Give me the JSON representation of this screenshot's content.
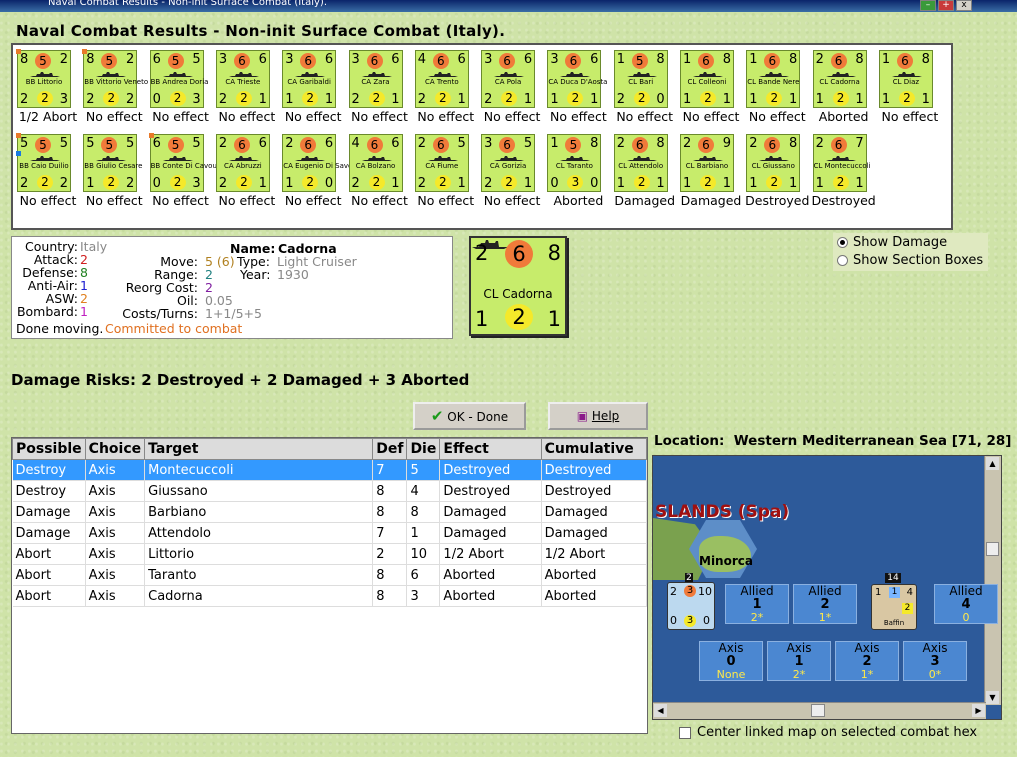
{
  "window": {
    "title": "Naval Combat Results - Non-init Surface Combat (Italy)."
  },
  "heading": "Naval Combat Results - Non-init Surface Combat (Italy).",
  "ships": [
    {
      "a": "8",
      "m": "5",
      "r": "2",
      "name": "BB Littorio",
      "b1": "2",
      "b2": "2",
      "b3": "3",
      "effect": "1/2 Abort",
      "dot": true
    },
    {
      "a": "8",
      "m": "5",
      "r": "2",
      "name": "BB Vittorio Veneto",
      "b1": "2",
      "b2": "2",
      "b3": "2",
      "effect": "No effect",
      "dot": true
    },
    {
      "a": "6",
      "m": "5",
      "r": "5",
      "name": "BB Andrea Doria",
      "b1": "0",
      "b2": "2",
      "b3": "3",
      "effect": "No effect"
    },
    {
      "a": "3",
      "m": "6",
      "r": "6",
      "name": "CA Trieste",
      "b1": "2",
      "b2": "2",
      "b3": "1",
      "effect": "No effect"
    },
    {
      "a": "3",
      "m": "6",
      "r": "6",
      "name": "CA Garibaldi",
      "b1": "1",
      "b2": "2",
      "b3": "1",
      "effect": "No effect"
    },
    {
      "a": "3",
      "m": "6",
      "r": "6",
      "name": "CA Zara",
      "b1": "2",
      "b2": "2",
      "b3": "1",
      "effect": "No effect"
    },
    {
      "a": "4",
      "m": "6",
      "r": "6",
      "name": "CA Trento",
      "b1": "2",
      "b2": "2",
      "b3": "1",
      "effect": "No effect"
    },
    {
      "a": "3",
      "m": "6",
      "r": "6",
      "name": "CA Pola",
      "b1": "2",
      "b2": "2",
      "b3": "1",
      "effect": "No effect"
    },
    {
      "a": "3",
      "m": "6",
      "r": "6",
      "name": "CA Duca D'Aosta",
      "b1": "1",
      "b2": "2",
      "b3": "1",
      "effect": "No effect"
    },
    {
      "a": "1",
      "m": "5",
      "r": "8",
      "name": "CL Bari",
      "b1": "2",
      "b2": "2",
      "b3": "0",
      "effect": "No effect"
    },
    {
      "a": "1",
      "m": "6",
      "r": "8",
      "name": "CL Colleoni",
      "b1": "1",
      "b2": "2",
      "b3": "1",
      "effect": "No effect"
    },
    {
      "a": "1",
      "m": "6",
      "r": "8",
      "name": "CL Bande Nere",
      "b1": "1",
      "b2": "2",
      "b3": "1",
      "effect": "No effect"
    },
    {
      "a": "2",
      "m": "6",
      "r": "8",
      "name": "CL Cadorna",
      "b1": "1",
      "b2": "2",
      "b3": "1",
      "effect": "Aborted"
    },
    {
      "a": "1",
      "m": "6",
      "r": "8",
      "name": "CL Diaz",
      "b1": "1",
      "b2": "2",
      "b3": "1",
      "effect": "No effect"
    },
    {
      "a": "5",
      "m": "5",
      "r": "5",
      "name": "BB Caio Duilio",
      "b1": "2",
      "b2": "2",
      "b3": "2",
      "effect": "No effect",
      "dot": true,
      "dotb": true
    },
    {
      "a": "5",
      "m": "5",
      "r": "5",
      "name": "BB Giulio Cesare",
      "b1": "1",
      "b2": "2",
      "b3": "2",
      "effect": "No effect"
    },
    {
      "a": "6",
      "m": "5",
      "r": "5",
      "name": "BB Conte Di Cavour",
      "b1": "0",
      "b2": "2",
      "b3": "3",
      "effect": "No effect",
      "dot": true
    },
    {
      "a": "2",
      "m": "6",
      "r": "6",
      "name": "CA Abruzzi",
      "b1": "2",
      "b2": "2",
      "b3": "1",
      "effect": "No effect"
    },
    {
      "a": "2",
      "m": "6",
      "r": "6",
      "name": "CA Eugenio Di Savoia",
      "b1": "1",
      "b2": "2",
      "b3": "0",
      "effect": "No effect"
    },
    {
      "a": "4",
      "m": "6",
      "r": "6",
      "name": "CA Bolzano",
      "b1": "2",
      "b2": "2",
      "b3": "1",
      "effect": "No effect"
    },
    {
      "a": "2",
      "m": "6",
      "r": "5",
      "name": "CA Fiume",
      "b1": "2",
      "b2": "2",
      "b3": "1",
      "effect": "No effect"
    },
    {
      "a": "3",
      "m": "6",
      "r": "5",
      "name": "CA Gorizia",
      "b1": "2",
      "b2": "2",
      "b3": "1",
      "effect": "No effect"
    },
    {
      "a": "1",
      "m": "5",
      "r": "8",
      "name": "CL Taranto",
      "b1": "0",
      "b2": "3",
      "b3": "0",
      "effect": "Aborted"
    },
    {
      "a": "2",
      "m": "6",
      "r": "8",
      "name": "CL Attendolo",
      "b1": "1",
      "b2": "2",
      "b3": "1",
      "effect": "Damaged"
    },
    {
      "a": "2",
      "m": "6",
      "r": "9",
      "name": "CL Barbiano",
      "b1": "1",
      "b2": "2",
      "b3": "1",
      "effect": "Damaged"
    },
    {
      "a": "2",
      "m": "6",
      "r": "8",
      "name": "CL Giussano",
      "b1": "1",
      "b2": "2",
      "b3": "1",
      "effect": "Destroyed"
    },
    {
      "a": "2",
      "m": "6",
      "r": "7",
      "name": "CL Montecuccoli",
      "b1": "1",
      "b2": "2",
      "b3": "1",
      "effect": "Destroyed"
    }
  ],
  "info": {
    "country_lbl": "Country:",
    "country": "Italy",
    "attack_lbl": "Attack:",
    "attack": "2",
    "defense_lbl": "Defense:",
    "defense": "8",
    "antiair_lbl": "Anti-Air:",
    "antiair": "1",
    "asw_lbl": "ASW:",
    "asw": "2",
    "bombard_lbl": "Bombard:",
    "bombard": "1",
    "name_lbl": "Name:",
    "name": "Cadorna",
    "move_lbl": "Move:",
    "move": "5 (6)",
    "type_lbl": "Type:",
    "type": "Light Cruiser",
    "range_lbl": "Range:",
    "range": "2",
    "year_lbl": "Year:",
    "year": "1930",
    "reorg_lbl": "Reorg Cost:",
    "reorg": "2",
    "oil_lbl": "Oil:",
    "oil": "0.05",
    "costs_lbl": "Costs/Turns:",
    "costs": "1+1/5+5",
    "done": "Done moving.",
    "committed": "Committed to combat"
  },
  "bigcard": {
    "a": "2",
    "m": "6",
    "r": "8",
    "name": "CL Cadorna",
    "b1": "1",
    "b2": "2",
    "b3": "1"
  },
  "options": {
    "show_damage": "Show Damage",
    "show_sections": "Show Section Boxes"
  },
  "risks": "Damage Risks: 2 Destroyed + 2 Damaged + 3 Aborted",
  "buttons": {
    "ok": "OK - Done",
    "help": "Help"
  },
  "table": {
    "headers": [
      "Possible",
      "Choice",
      "Target",
      "Def",
      "Die",
      "Effect",
      "Cumulative"
    ],
    "rows": [
      [
        "Destroy",
        "Axis",
        "Montecuccoli",
        "7",
        "5",
        "Destroyed",
        "Destroyed"
      ],
      [
        "Destroy",
        "Axis",
        "Giussano",
        "8",
        "4",
        "Destroyed",
        "Destroyed"
      ],
      [
        "Damage",
        "Axis",
        "Barbiano",
        "8",
        "8",
        "Damaged",
        "Damaged"
      ],
      [
        "Damage",
        "Axis",
        "Attendolo",
        "7",
        "1",
        "Damaged",
        "Damaged"
      ],
      [
        "Abort",
        "Axis",
        "Littorio",
        "2",
        "10",
        "1/2 Abort",
        "1/2 Abort"
      ],
      [
        "Abort",
        "Axis",
        "Taranto",
        "8",
        "6",
        "Aborted",
        "Aborted"
      ],
      [
        "Abort",
        "Axis",
        "Cadorna",
        "8",
        "3",
        "Aborted",
        "Aborted"
      ]
    ]
  },
  "location": {
    "label": "Location:",
    "value": "Western Mediterranean Sea [71, 28]"
  },
  "map": {
    "islands": "SLANDS (Spa)",
    "minorca": "Minorca",
    "stack1": "2",
    "stack2": "14",
    "unit_name": "Baffin",
    "allied": [
      {
        "label": "Allied",
        "v": "1",
        "s": "2*"
      },
      {
        "label": "Allied",
        "v": "2",
        "s": "1*"
      },
      {
        "label": "Allied",
        "v": "4",
        "s": "0"
      }
    ],
    "axis": [
      {
        "label": "Axis",
        "v": "0",
        "s": "None"
      },
      {
        "label": "Axis",
        "v": "1",
        "s": "2*"
      },
      {
        "label": "Axis",
        "v": "2",
        "s": "1*"
      },
      {
        "label": "Axis",
        "v": "3",
        "s": "0*"
      }
    ],
    "ucard": {
      "a": "2",
      "m": "3",
      "r": "10",
      "b1": "0",
      "b2": "3",
      "b3": "0"
    },
    "bcard": {
      "a": "1",
      "m": "1",
      "r": "4",
      "b2": "2"
    }
  },
  "center_link": "Center linked map on selected combat hex"
}
